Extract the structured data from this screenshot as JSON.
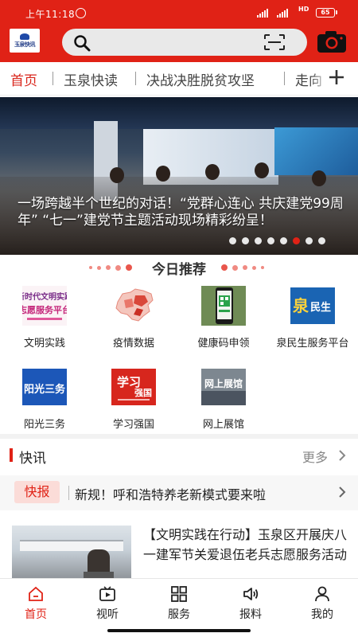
{
  "status_bar": {
    "time": "上午11:18",
    "network": "HD",
    "battery": "65"
  },
  "header": {
    "logo_text": "玉泉快讯"
  },
  "tabs": [
    {
      "label": "首页",
      "active": true
    },
    {
      "label": "玉泉快读",
      "active": false
    },
    {
      "label": "决战决胜脱贫攻坚",
      "active": false
    },
    {
      "label": "走向",
      "active": false
    }
  ],
  "banner": {
    "caption": "一场跨越半个世纪的对话！“党群心连心 共庆建党99周年” “七一”建党节主题活动现场精彩纷呈！",
    "slide_count": 8,
    "active_slide": 6
  },
  "recommend": {
    "title": "今日推荐",
    "items": [
      {
        "label": "文明实践",
        "icon": "civilization-practice-icon",
        "icon_text": "新时代文明实践志愿服务平台"
      },
      {
        "label": "疫情数据",
        "icon": "epidemic-map-icon"
      },
      {
        "label": "健康码申领",
        "icon": "health-code-icon"
      },
      {
        "label": "泉民生服务平台",
        "icon": "quan-minsheng-icon",
        "icon_text": "泉民生"
      },
      {
        "label": "阳光三务",
        "icon": "sunshine-affairs-icon",
        "icon_text": "阳光三务"
      },
      {
        "label": "学习强国",
        "icon": "xuexi-qiangguo-icon",
        "icon_text": "学习强国"
      },
      {
        "label": "网上展馆",
        "icon": "online-exhibition-icon",
        "icon_text": "网上展馆"
      }
    ]
  },
  "flash": {
    "title": "快讯",
    "more": "更多",
    "badge": "快报",
    "headline": "新规！呼和浩特养老新模式要来啦"
  },
  "article": {
    "title": "【文明实践在行动】玉泉区开展庆八一建军节关爱退伍老兵志愿服务活动"
  },
  "bottom_nav": [
    {
      "label": "首页",
      "icon": "home-icon",
      "active": true
    },
    {
      "label": "视听",
      "icon": "video-icon",
      "active": false
    },
    {
      "label": "服务",
      "icon": "grid-icon",
      "active": false
    },
    {
      "label": "报料",
      "icon": "speaker-icon",
      "active": false
    },
    {
      "label": "我的",
      "icon": "user-icon",
      "active": false
    }
  ],
  "colors": {
    "brand_red": "#e02216",
    "tab_active": "#d9261c",
    "badge_bg": "#fbdcd8"
  }
}
